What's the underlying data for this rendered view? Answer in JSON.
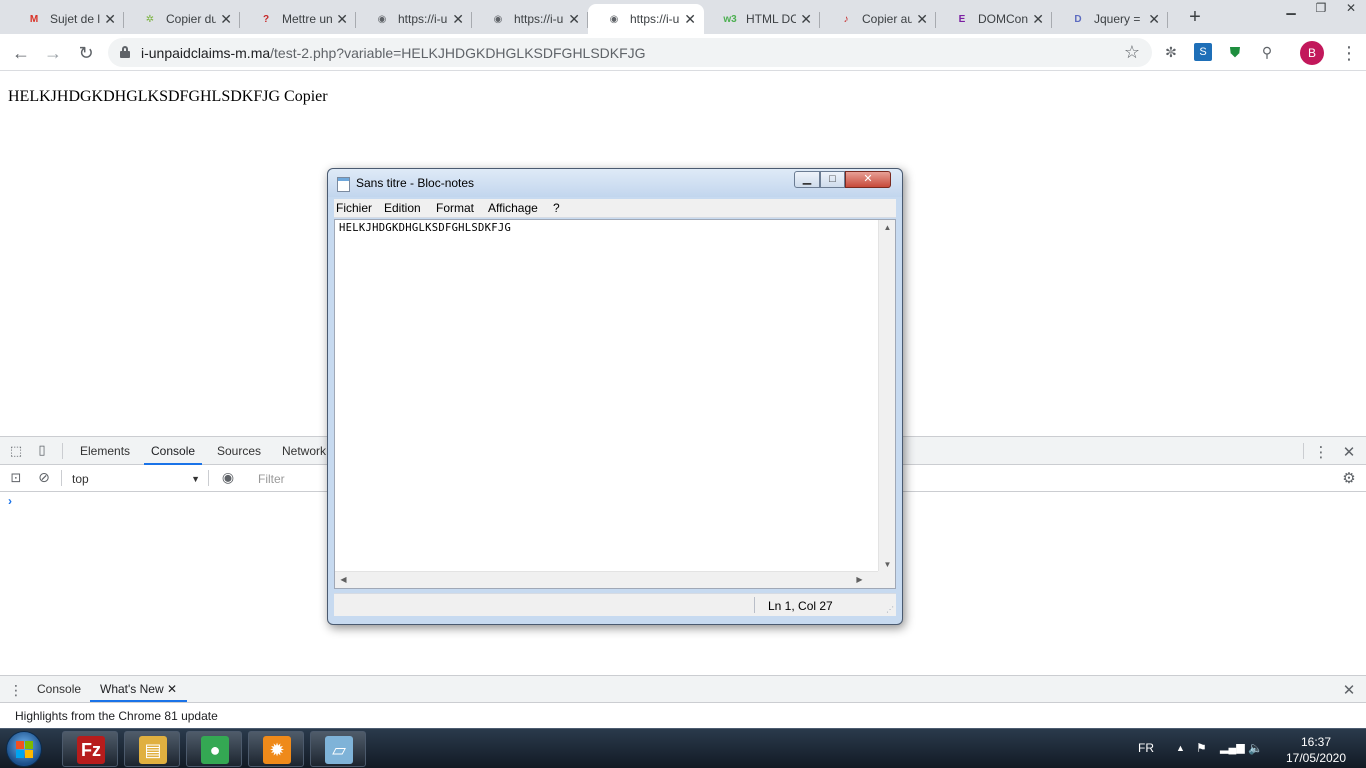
{
  "browser": {
    "tabs": [
      {
        "label": "Sujet de l",
        "icon": "gmail-icon",
        "icon_text": "M",
        "icon_color": "#d93025",
        "active": false
      },
      {
        "label": "Copier du",
        "icon": "puzzle-icon",
        "icon_text": "✲",
        "icon_color": "#7cb342",
        "active": false
      },
      {
        "label": "Mettre un",
        "icon": "question-icon",
        "icon_text": "?",
        "icon_color": "#c62828",
        "active": false
      },
      {
        "label": "https://i-u",
        "icon": "globe-icon",
        "icon_text": "◉",
        "icon_color": "#5f6368",
        "active": false
      },
      {
        "label": "https://i-u",
        "icon": "globe-icon",
        "icon_text": "◉",
        "icon_color": "#5f6368",
        "active": false
      },
      {
        "label": "https://i-u",
        "icon": "globe-icon",
        "icon_text": "◉",
        "icon_color": "#5f6368",
        "active": true
      },
      {
        "label": "HTML DO",
        "icon": "w3schools-icon",
        "icon_text": "w3",
        "icon_color": "#4caf50",
        "active": false
      },
      {
        "label": "Copier au",
        "icon": "link-icon",
        "icon_text": "♪",
        "icon_color": "#c62828",
        "active": false
      },
      {
        "label": "DOMCont",
        "icon": "e-icon",
        "icon_text": "E",
        "icon_color": "#7b1fa2",
        "active": false
      },
      {
        "label": "Jquery = ",
        "icon": "jquery-icon",
        "icon_text": "D",
        "icon_color": "#5c6bc0",
        "active": false
      }
    ],
    "url_domain": "i-unpaidclaims-m.ma",
    "url_path": "/test-2.php?variable=HELKJHDGKDHGLKSDFGHLSDKFJG",
    "profile_initial": "B",
    "profile_color": "#c2185b"
  },
  "page": {
    "text": "HELKJHDGKDHGLKSDFGHLSDKFJG Copier"
  },
  "devtools": {
    "tabs": [
      "Elements",
      "Console",
      "Sources",
      "Network"
    ],
    "active_tab": "Console",
    "context": "top",
    "filter_placeholder": "Filter",
    "prompt": "›",
    "drawer_tabs": [
      "Console",
      "What's New"
    ],
    "drawer_active": "What's New",
    "drawer_text": "Highlights from the Chrome 81 update"
  },
  "notepad": {
    "title": "Sans titre - Bloc-notes",
    "menu": [
      "Fichier",
      "Edition",
      "Format",
      "Affichage",
      "?"
    ],
    "content": "HELKJHDGKDHGLKSDFGHLSDKFJG",
    "status": "Ln 1, Col 27"
  },
  "taskbar": {
    "apps": [
      {
        "name": "filezilla-icon",
        "glyph": "Fz",
        "color": "#b71c1c"
      },
      {
        "name": "explorer-icon",
        "glyph": "▤",
        "color": "#e0b040"
      },
      {
        "name": "chrome-icon",
        "glyph": "●",
        "color": "#34a853"
      },
      {
        "name": "settings-app-icon",
        "glyph": "✹",
        "color": "#ef8a1a"
      },
      {
        "name": "notepad-app-icon",
        "glyph": "▱",
        "color": "#7fb3d8"
      }
    ],
    "lang": "FR",
    "time": "16:37",
    "date": "17/05/2020"
  }
}
